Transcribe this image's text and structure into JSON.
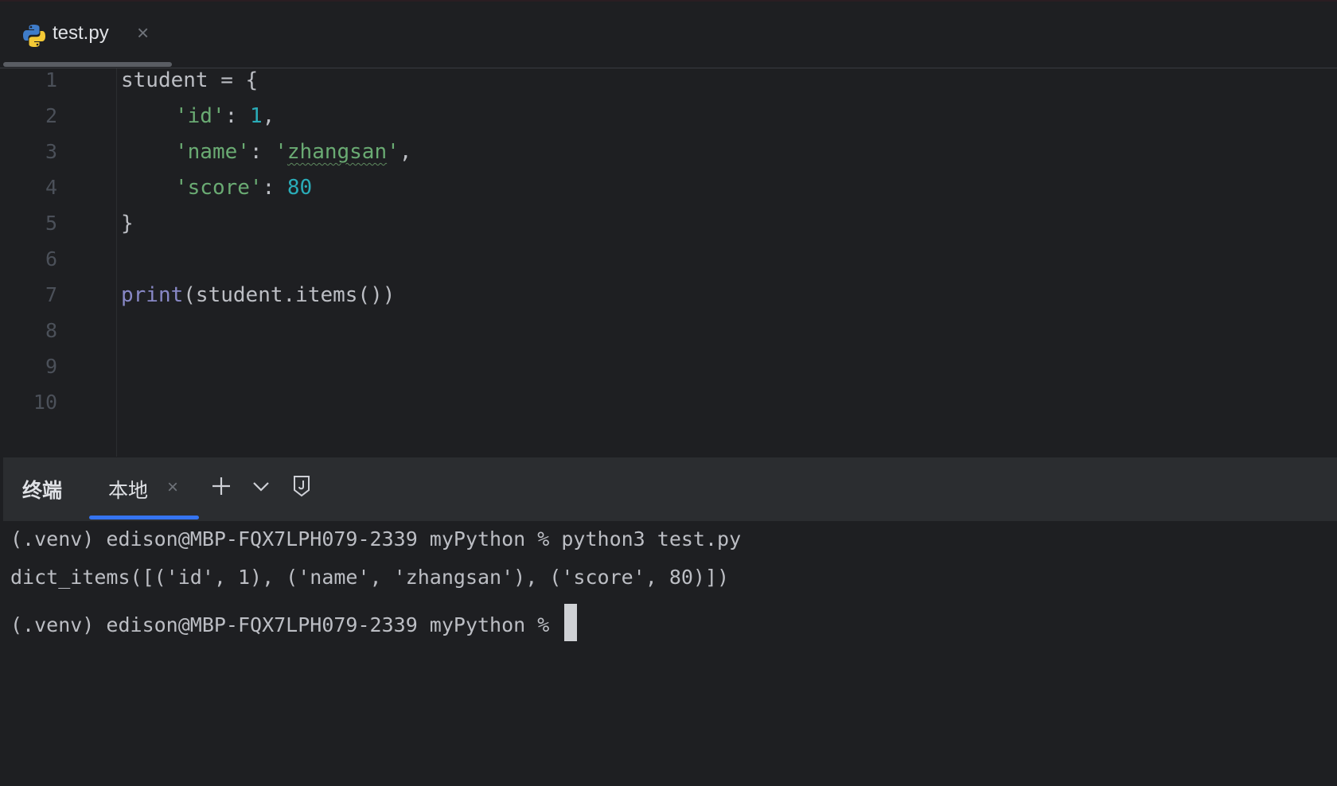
{
  "editor_tab": {
    "title": "test.py",
    "close_glyph": "×",
    "icon": "python-file-icon"
  },
  "editor": {
    "line_numbers": [
      "1",
      "2",
      "3",
      "4",
      "5",
      "6",
      "7",
      "8",
      "9",
      "10"
    ],
    "code": {
      "l1": "student = {",
      "l2_key": "'id'",
      "l2_colon": ": ",
      "l2_val": "1",
      "l2_comma": ",",
      "l3_key": "'name'",
      "l3_colon": ": ",
      "l3_q1": "'",
      "l3_val": "zhangsan",
      "l3_q2": "'",
      "l3_comma": ",",
      "l4_key": "'score'",
      "l4_colon": ": ",
      "l4_val": "80",
      "l5": "}",
      "l7_fn": "print",
      "l7_rest": "(student.items())"
    }
  },
  "terminal_panel": {
    "title": "终端",
    "tab_local": "本地",
    "close_glyph": "×",
    "tools": [
      "plus-icon",
      "chevron-down-icon",
      "pin-icon"
    ]
  },
  "terminal": {
    "line1": "(.venv) edison@MBP-FQX7LPH079-2339 myPython % python3 test.py",
    "line2": "dict_items([('id', 1), ('name', 'zhangsan'), ('score', 80)])",
    "line3": "(.venv) edison@MBP-FQX7LPH079-2339 myPython % "
  },
  "colors": {
    "background": "#1e1f22",
    "string": "#6aab73",
    "number": "#2aacb8",
    "builtin": "#8888c6",
    "accent": "#3574f0"
  }
}
